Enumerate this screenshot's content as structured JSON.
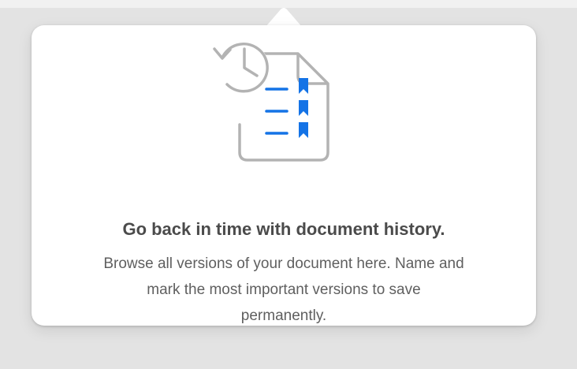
{
  "onboarding_popover": {
    "illustration_icon": "document-history-icon",
    "title": "Go back in time with document history.",
    "description": "Browse all versions of your document here. Name and mark the most important versions to save permanently."
  },
  "colors": {
    "accent": "#1473e6",
    "icon_gray": "#b3b3b3",
    "title": "#4b4b4b",
    "body": "#5f5f5f"
  }
}
